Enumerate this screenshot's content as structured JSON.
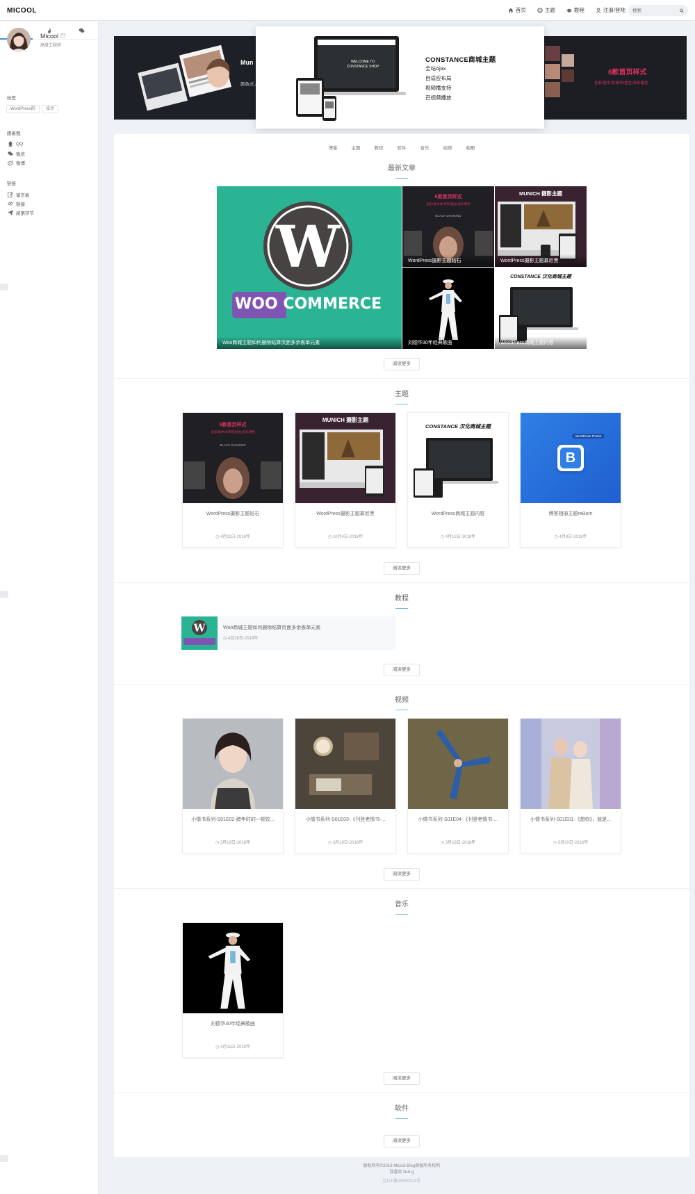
{
  "header": {
    "logo": "MICOOL",
    "nav": [
      {
        "label": "首页",
        "icon": "home-icon"
      },
      {
        "label": "主题",
        "icon": "palette-icon"
      },
      {
        "label": "教程",
        "icon": "graduation-icon"
      },
      {
        "label": "注册/登陆",
        "icon": "user-icon"
      }
    ],
    "search_placeholder": "搜索"
  },
  "sidebar": {
    "tabs": [
      "user-icon",
      "fire-icon",
      "comments-icon"
    ],
    "profile_name": "Micool",
    "profile_title": "高级工程师",
    "tags_label": "标签",
    "tags": [
      "WordPress的",
      "设计"
    ],
    "follow_label": "跟着我",
    "follow": [
      {
        "label": "QQ",
        "icon": "qq-icon"
      },
      {
        "label": "微信",
        "icon": "wechat-icon"
      },
      {
        "label": "微博",
        "icon": "weibo-icon"
      }
    ],
    "links_label": "链接",
    "links": [
      {
        "label": "留言板",
        "icon": "edit-icon"
      },
      {
        "label": "链接",
        "icon": "link-icon"
      },
      {
        "label": "阅第环节",
        "icon": "send-icon"
      }
    ]
  },
  "banner": {
    "left_text": "Mun",
    "left_sub": "颜色式 /",
    "main_title": "CONSTANCE商城主题",
    "main_lines": [
      "全站Ajax",
      "自适应布局",
      "视频播支持",
      "召视频播放"
    ],
    "screen_text": "WELCOME TO CONSTANCE SHOP",
    "right_title": "6款首页样式",
    "right_sub": "全彩/居中式/单列/居左/多彩暗色"
  },
  "categories": [
    "博客",
    "主题",
    "教程",
    "软件",
    "音乐",
    "视频",
    "相册"
  ],
  "sections": {
    "latest": "最新文章",
    "themes": "主题",
    "tutorials": "教程",
    "videos": "视频",
    "music": "音乐",
    "software": "软件"
  },
  "read_more": "阅读更多",
  "latest": {
    "big_caption": "Woo商城主题如何删除结算页面多余表单元素",
    "tiles": [
      {
        "caption": "WordPress摄影主题钻石",
        "heading": "6款首页样式",
        "sub": "全彩/居中式/单列/居左/多彩暗色",
        "brand": "BLACK DIAMOND"
      },
      {
        "caption": "WordPress摄影主题慕尼黑",
        "heading": "MUNICH 摄影主题"
      },
      {
        "caption": "刘德华30年经典歌曲"
      },
      {
        "caption": "WordPress商城主题内容",
        "heading": "CONSTANCE 汉化商城主题"
      }
    ],
    "woo_text": "WOO COMMERCE"
  },
  "themes": [
    {
      "title": "WordPress摄影主题钻石",
      "date": "4月11日-2018年"
    },
    {
      "title": "WordPress摄影主题慕尼黑",
      "date": "10月4日-2018年"
    },
    {
      "title": "WordPress商城主题内容",
      "date": "4月12日-2018年"
    },
    {
      "title": "博客相册主题reBorn",
      "date": "4月9日-2018年",
      "badge": "WordPress Theme",
      "letter": "B"
    }
  ],
  "tutorial": {
    "title": "Woo商城主题如何删除结算页面多余表单元素",
    "date": "4月28日-2018年"
  },
  "videos": [
    {
      "title": "小情书系列-S01E02-跨年时的一顿饺...",
      "date": "3月19日-2018年"
    },
    {
      "title": "小情书系列-S01E03-《刊登老情书-...",
      "date": "3月19日-2018年"
    },
    {
      "title": "小情书系列-S01E04-《刊登老情书-...",
      "date": "3月19日-2018年"
    },
    {
      "title": "小情书系列-S01E01-《想你》，就是...",
      "date": "3月10日-2018年"
    }
  ],
  "music": [
    {
      "title": "刘德华30年经典歌曲",
      "date": "4月11日-2018年"
    }
  ],
  "footer": {
    "line1": "版权所有©2018 Micool Blog保留所有权利",
    "line2": "我喜欢 Null.g",
    "line3": "辽ICP备18000014号"
  },
  "colors": {
    "accent": "#3a8ee6",
    "woo_green": "#2bb494",
    "woo_purple": "#7f54b3"
  }
}
